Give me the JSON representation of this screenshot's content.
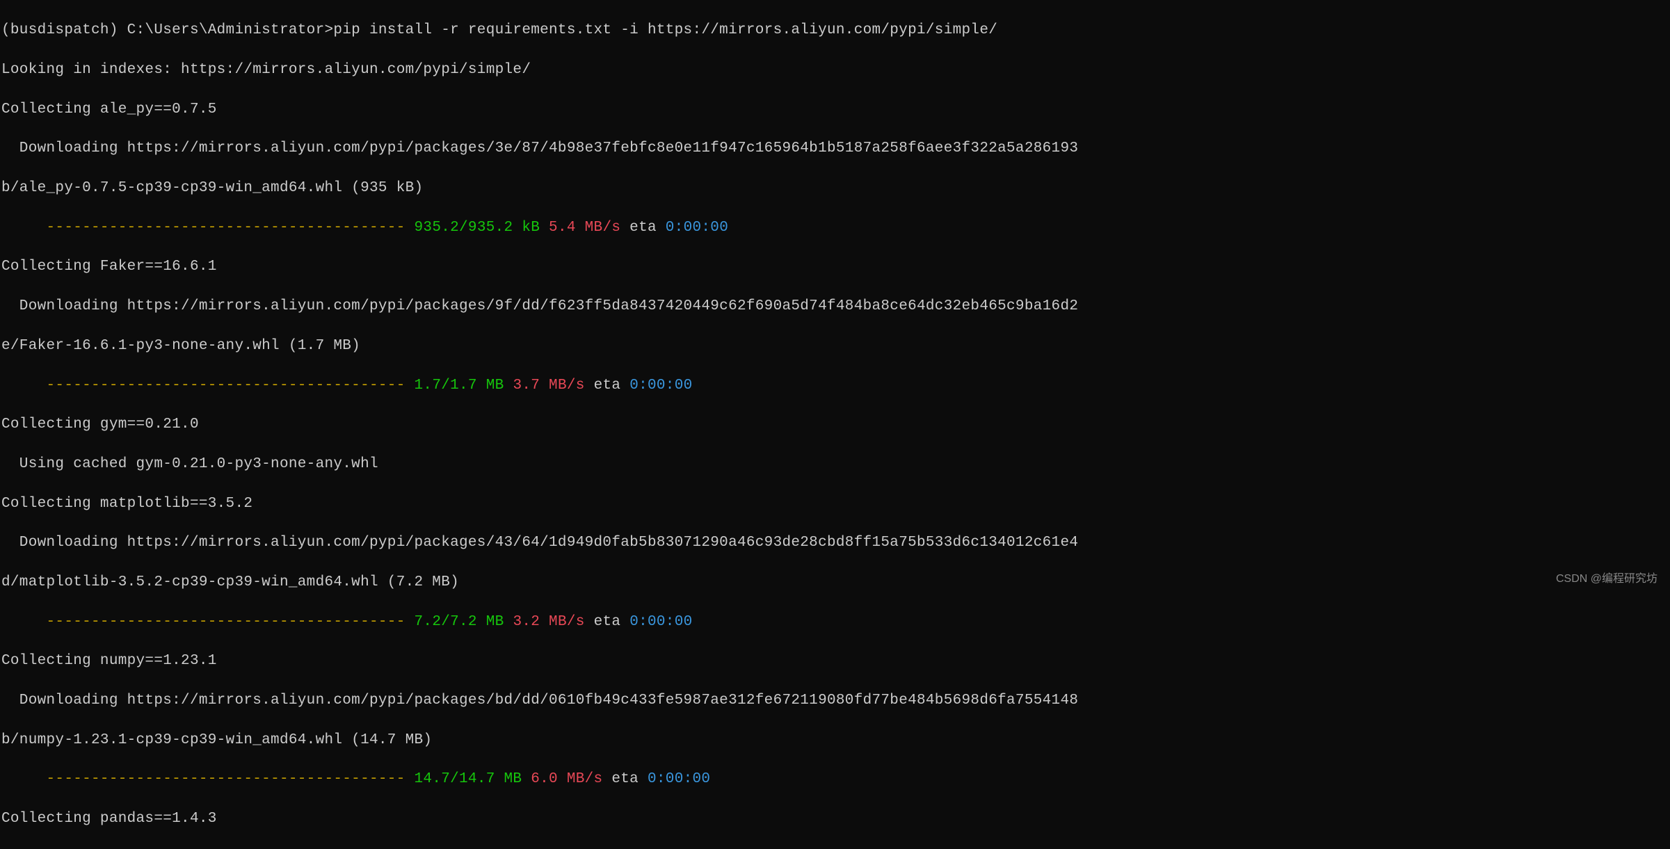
{
  "lines": {
    "l0": "(busdispatch) C:\\Users\\Administrator>pip install -r requirements.txt -i https://mirrors.aliyun.com/pypi/simple/",
    "l1": "Looking in indexes: https://mirrors.aliyun.com/pypi/simple/",
    "l2": "Collecting ale_py==0.7.5",
    "l3": "  Downloading https://mirrors.aliyun.com/pypi/packages/3e/87/4b98e37febfc8e0e11f947c165964b1b5187a258f6aee3f322a5a286193",
    "l4": "b/ale_py-0.7.5-cp39-cp39-win_amd64.whl (935 kB)",
    "l5_pad": "     ",
    "l5_bar": "----------------------------------------",
    "l5_size": " 935.2/935.2 kB",
    "l5_speed": " 5.4 MB/s",
    "l5_eta_label": " eta ",
    "l5_eta": "0:00:00",
    "l6": "Collecting Faker==16.6.1",
    "l7": "  Downloading https://mirrors.aliyun.com/pypi/packages/9f/dd/f623ff5da8437420449c62f690a5d74f484ba8ce64dc32eb465c9ba16d2",
    "l8": "e/Faker-16.6.1-py3-none-any.whl (1.7 MB)",
    "l9_pad": "     ",
    "l9_bar": "----------------------------------------",
    "l9_size": " 1.7/1.7 MB",
    "l9_speed": " 3.7 MB/s",
    "l9_eta_label": " eta ",
    "l9_eta": "0:00:00",
    "l10": "Collecting gym==0.21.0",
    "l11": "  Using cached gym-0.21.0-py3-none-any.whl",
    "l12": "Collecting matplotlib==3.5.2",
    "l13": "  Downloading https://mirrors.aliyun.com/pypi/packages/43/64/1d949d0fab5b83071290a46c93de28cbd8ff15a75b533d6c134012c61e4",
    "l14": "d/matplotlib-3.5.2-cp39-cp39-win_amd64.whl (7.2 MB)",
    "l15_pad": "     ",
    "l15_bar": "----------------------------------------",
    "l15_size": " 7.2/7.2 MB",
    "l15_speed": " 3.2 MB/s",
    "l15_eta_label": " eta ",
    "l15_eta": "0:00:00",
    "l16": "Collecting numpy==1.23.1",
    "l17": "  Downloading https://mirrors.aliyun.com/pypi/packages/bd/dd/0610fb49c433fe5987ae312fe672119080fd77be484b5698d6fa7554148",
    "l18": "b/numpy-1.23.1-cp39-cp39-win_amd64.whl (14.7 MB)",
    "l19_pad": "     ",
    "l19_bar": "----------------------------------------",
    "l19_size": " 14.7/14.7 MB",
    "l19_speed": " 6.0 MB/s",
    "l19_eta_label": " eta ",
    "l19_eta": "0:00:00",
    "l20": "Collecting pandas==1.4.3"
  },
  "watermark": "CSDN @编程研究坊"
}
